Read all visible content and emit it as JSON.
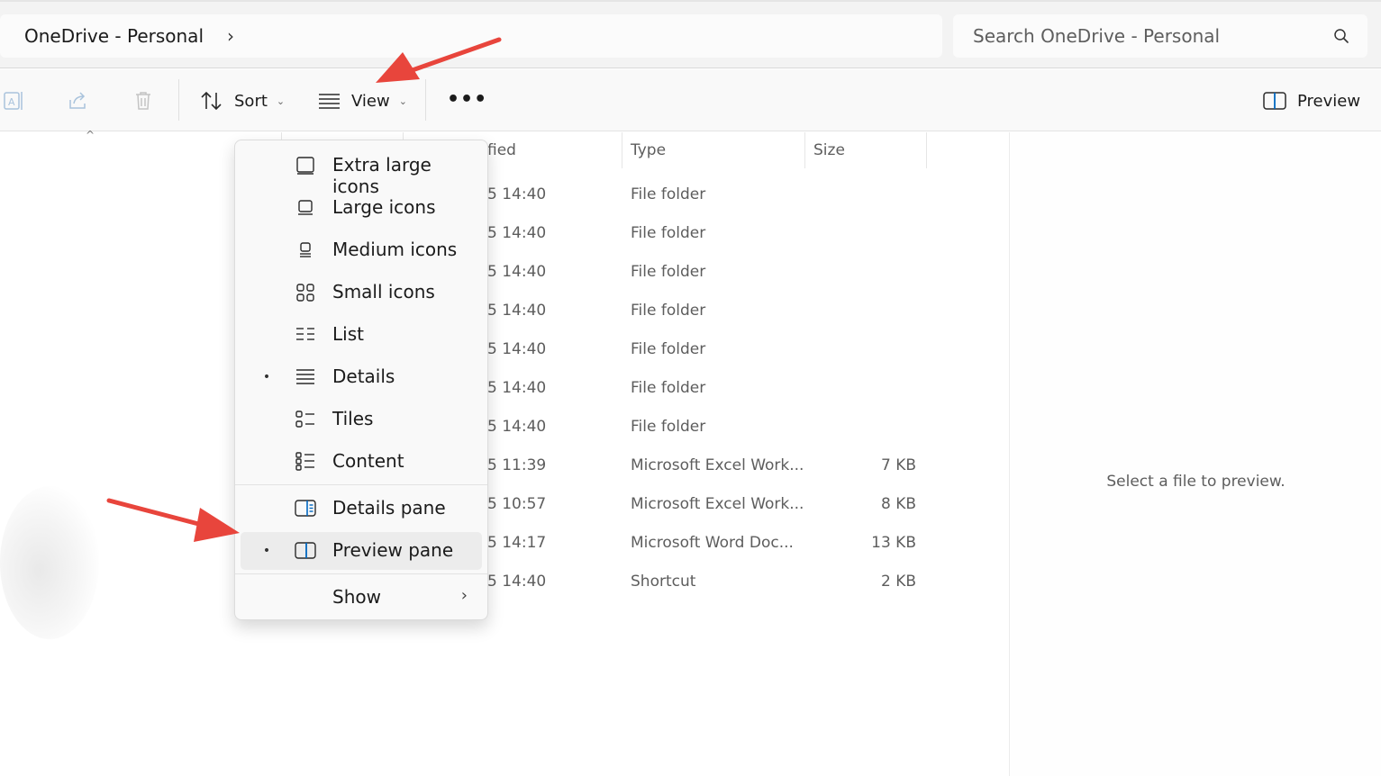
{
  "address": {
    "location": "OneDrive - Personal",
    "chevron": "›"
  },
  "search": {
    "placeholder": "Search OneDrive - Personal",
    "icon": "search-icon"
  },
  "toolbar": {
    "sort_label": "Sort",
    "view_label": "View",
    "more_label": "•••",
    "preview_label": "Preview",
    "icons": [
      "rename-icon",
      "share-icon",
      "delete-icon",
      "sort-icon",
      "view-details-icon",
      "more-icon",
      "preview-pane-icon"
    ]
  },
  "columns": {
    "modified_partial": "fied",
    "type": "Type",
    "size": "Size"
  },
  "rows": [
    {
      "date": "5 14:40",
      "type": "File folder",
      "size": ""
    },
    {
      "date": "5 14:40",
      "type": "File folder",
      "size": ""
    },
    {
      "date": "5 14:40",
      "type": "File folder",
      "size": ""
    },
    {
      "date": "5 14:40",
      "type": "File folder",
      "size": ""
    },
    {
      "date": "5 14:40",
      "type": "File folder",
      "size": ""
    },
    {
      "date": "5 14:40",
      "type": "File folder",
      "size": ""
    },
    {
      "date": "5 14:40",
      "type": "File folder",
      "size": ""
    },
    {
      "date": "5 11:39",
      "type": "Microsoft Excel Work...",
      "size": "7 KB"
    },
    {
      "date": "5 10:57",
      "type": "Microsoft Excel Work...",
      "size": "8 KB"
    },
    {
      "date": "5 14:17",
      "type": "Microsoft Word Doc...",
      "size": "13 KB"
    },
    {
      "date": "5 14:40",
      "type": "Shortcut",
      "size": "2 KB"
    }
  ],
  "preview_pane": {
    "message": "Select a file to preview."
  },
  "view_menu": {
    "layouts": [
      {
        "label": "Extra large icons",
        "icon": "extra-large-icons-icon",
        "selected": false
      },
      {
        "label": "Large icons",
        "icon": "large-icons-icon",
        "selected": false
      },
      {
        "label": "Medium icons",
        "icon": "medium-icons-icon",
        "selected": false
      },
      {
        "label": "Small icons",
        "icon": "small-icons-icon",
        "selected": false
      },
      {
        "label": "List",
        "icon": "list-icon",
        "selected": false
      },
      {
        "label": "Details",
        "icon": "details-icon",
        "selected": true
      },
      {
        "label": "Tiles",
        "icon": "tiles-icon",
        "selected": false
      },
      {
        "label": "Content",
        "icon": "content-icon",
        "selected": false
      }
    ],
    "panes": [
      {
        "label": "Details pane",
        "icon": "details-pane-icon",
        "selected": false
      },
      {
        "label": "Preview pane",
        "icon": "preview-pane-icon",
        "selected": true
      }
    ],
    "show": {
      "label": "Show",
      "chevron": "›"
    },
    "bullet": "•"
  },
  "colors": {
    "accent": "#0067c0",
    "arrow": "#e8453c",
    "menu_bg": "#f9f9f9",
    "selected_bg": "#ececec"
  }
}
